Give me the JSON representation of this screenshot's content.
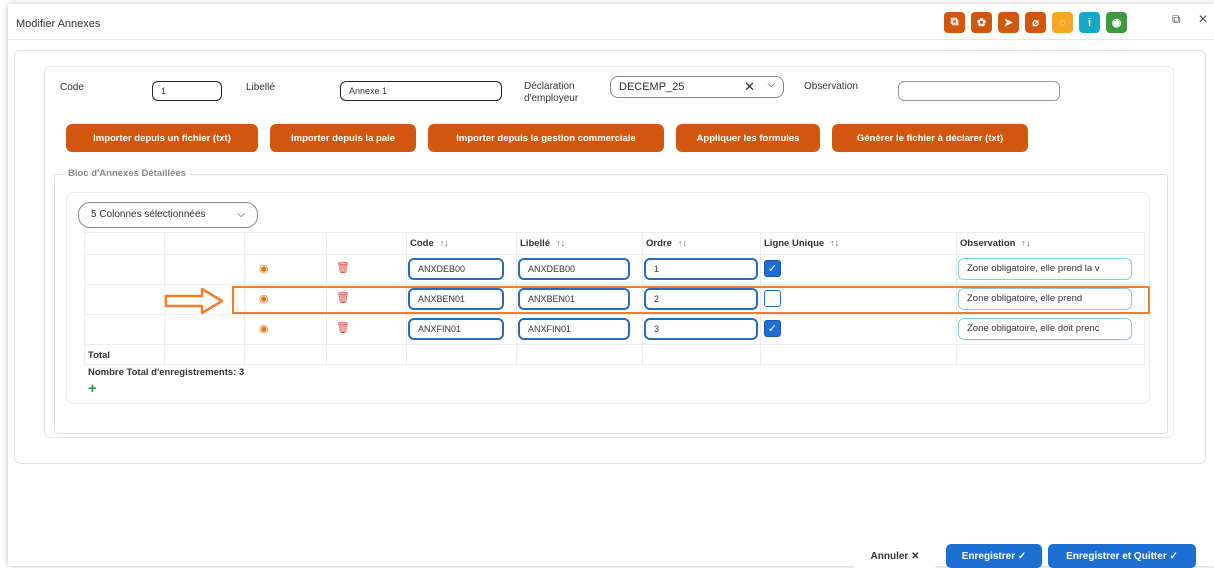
{
  "window": {
    "title": "Modifier Annexes"
  },
  "toolbar_icons": [
    {
      "name": "layers-icon",
      "glyph": "⧉",
      "color": "#d2570e"
    },
    {
      "name": "settings-icon",
      "glyph": "✿",
      "color": "#d2570e"
    },
    {
      "name": "send-icon",
      "glyph": "➤",
      "color": "#d2570e"
    },
    {
      "name": "attachment-icon",
      "glyph": "⌀",
      "color": "#d2570e"
    },
    {
      "name": "comment-icon",
      "glyph": "◌",
      "color": "#f5a623"
    },
    {
      "name": "info-icon",
      "glyph": "i",
      "color": "#19a7c9"
    },
    {
      "name": "eye-icon",
      "glyph": "◉",
      "color": "#3d9a3d"
    }
  ],
  "form": {
    "code_label": "Code",
    "code_value": "1",
    "libelle_label": "Libellé",
    "libelle_value": "Annexe 1",
    "declaration_label_1": "Déclaration",
    "declaration_label_2": "d'employeur",
    "declaration_value": "DECEMP_25",
    "observation_label": "Observation",
    "observation_value": ""
  },
  "actions": {
    "import_file": "Importer depuis un fichier (txt)",
    "import_paie": "Importer depuis la paie",
    "import_gestion": "Importer depuis la gestion commerciale",
    "apply_formulas": "Appliquer les formules",
    "generate_file": "Générer le fichier à déclarer (txt)"
  },
  "bloc": {
    "legend": "Bloc d'Annexes Détaillées",
    "columns_selector": "5 Colonnes sélectionnées",
    "headers": {
      "code": "Code",
      "libelle": "Libellé",
      "ordre": "Ordre",
      "ligne_unique": "Ligne Unique",
      "observation": "Observation",
      "sort_glyph": "↑↓"
    },
    "rows": [
      {
        "code": "ANXDEB00",
        "libelle": "ANXDEB00",
        "ordre": "1",
        "ligne_unique": true,
        "observation": "Zone obligatoire, elle prend la v"
      },
      {
        "code": "ANXBEN01",
        "libelle": "ANXBEN01",
        "ordre": "2",
        "ligne_unique": false,
        "observation": "Zone obligatoire,   elle   prend"
      },
      {
        "code": "ANXFIN01",
        "libelle": "ANXFIN01",
        "ordre": "3",
        "ligne_unique": true,
        "observation": "Zone obligatoire, elle doit prenc"
      }
    ],
    "total_label": "Total",
    "count_label": "Nombre Total d'enregistrements: 3"
  },
  "footer": {
    "cancel": "Annuler ✕",
    "save": "Enregistrer ✓",
    "save_quit": "Enregistrer et Quitter ✓"
  },
  "colors": {
    "accent_orange": "#d2570e",
    "primary_blue": "#1e6fd3",
    "highlight": "#ef7d2a"
  }
}
